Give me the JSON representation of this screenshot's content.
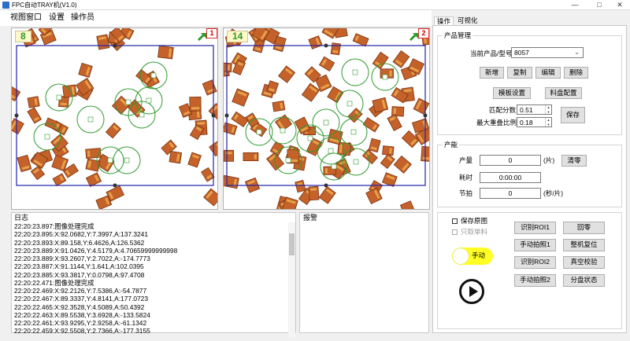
{
  "window": {
    "title": "FPC自动TRAY机(V1.0)",
    "minimize_glyph": "—",
    "maximize_glyph": "□",
    "close_glyph": "✕"
  },
  "menu": [
    "视图窗口",
    "设置",
    "操作员"
  ],
  "cameras": [
    {
      "count": "8",
      "index": "1"
    },
    {
      "count": "14",
      "index": "2"
    }
  ],
  "log": {
    "title": "日志",
    "lines": [
      "22:20:23.897:图像处理完成",
      "22:20:23.895:X:92.0682,Y:7.3997,A:137.3241",
      "22:20:23.893:X:89.158,Y:6.4626,A:126.5362",
      "22:20:23.889:X:91.0426,Y:4.5179,A:4.70659999999998",
      "22:20:23.889:X:93.2607,Y:2.7022,A:-174.7773",
      "22:20:23.887:X:91.1144,Y:1.641,A:102.0395",
      "22:20:23.885:X:93.3817,Y:0.0798,A:97.4708",
      "22:20:22.471:图像处理完成",
      "22:20:22.469:X:92.2126,Y:7.5386,A:-54.7877",
      "22:20:22.467:X:89.3337,Y:4.8141,A:177.0723",
      "22:20:22.465:X:92.3528,Y:4.5089,A:50.4392",
      "22:20:22.463:X:89.5538,Y:3.6928,A:-133.5824",
      "22:20:22.461:X:93.9295,Y:2.9258,A:-61.1342",
      "22:20:22.459:X:92.5508,Y:2.7366,A:-177.3155"
    ]
  },
  "alarm": {
    "title": "报警"
  },
  "tabs": [
    "操作",
    "可视化"
  ],
  "product": {
    "group_title": "产品管理",
    "current_label": "当前产品/型号",
    "current_value": "8057",
    "buttons": [
      "新增",
      "复制",
      "编辑",
      "删除"
    ],
    "template_btn": "模板设置",
    "tray_btn": "料盘配置",
    "match_label": "匹配分数",
    "match_value": "0.51",
    "overlap_label": "最大重叠比例",
    "overlap_value": "0.18",
    "save_btn": "保存"
  },
  "capacity": {
    "group_title": "产能",
    "output_label": "产量",
    "output_value": "0",
    "output_unit": "(片)",
    "clear_btn": "清零",
    "time_label": "耗时",
    "time_value": "0:00:00",
    "cycle_label": "节拍",
    "cycle_value": "0",
    "cycle_unit": "(秒/片)"
  },
  "controls": {
    "save_image": "保存原图",
    "only_pick": "只取单料",
    "mode": "手动",
    "buttons": [
      [
        "识别ROI1",
        "回零"
      ],
      [
        "手动拍照1",
        "整机复位"
      ],
      [
        "识别ROI2",
        "真空校验"
      ],
      [
        "手动拍照2",
        "分盘状态"
      ]
    ]
  },
  "colors": {
    "accent_green": "#2d9a2d",
    "roi_blue": "#2222aa",
    "toggle_yellow": "#ffff24",
    "part_orange": "#c4622a"
  }
}
